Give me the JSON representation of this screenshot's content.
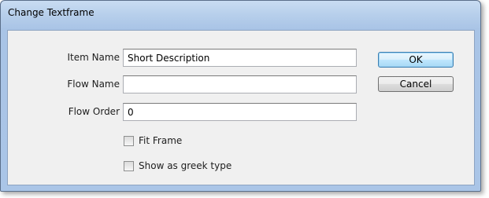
{
  "dialog": {
    "title": "Change Textframe"
  },
  "form": {
    "item_name_label": "Item Name",
    "item_name_value": "Short Description",
    "flow_name_label": "Flow Name",
    "flow_name_value": "",
    "flow_order_label": "Flow Order",
    "flow_order_value": "0",
    "fit_frame_label": "Fit Frame",
    "fit_frame_checked": false,
    "greek_label": "Show as greek type",
    "greek_checked": false
  },
  "buttons": {
    "ok_label": "OK",
    "cancel_label": "Cancel"
  }
}
